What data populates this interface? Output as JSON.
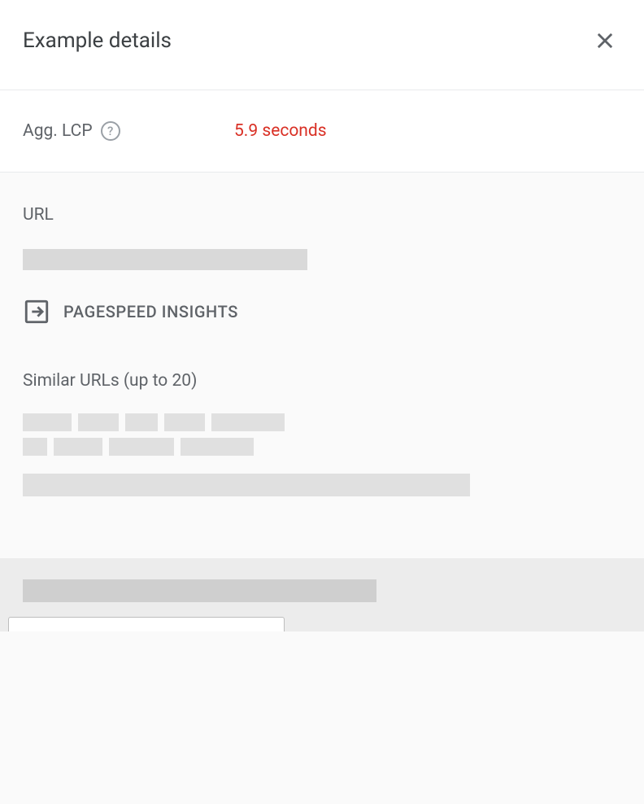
{
  "header": {
    "title": "Example details"
  },
  "metric": {
    "label": "Agg. LCP",
    "value": "5.9 seconds"
  },
  "sections": {
    "url_label": "URL",
    "psi_link": "PAGESPEED INSIGHTS",
    "similar_label": "Similar URLs (up to 20)"
  },
  "colors": {
    "warn": "#d93025"
  }
}
